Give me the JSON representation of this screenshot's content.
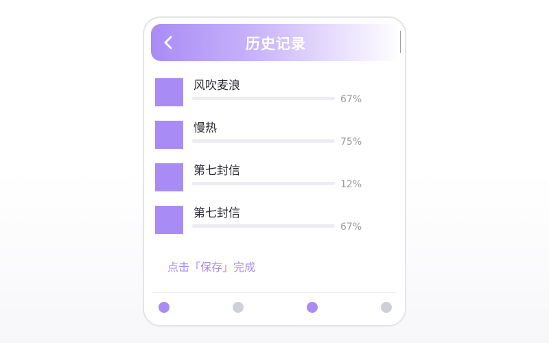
{
  "header": {
    "title": "历史记录",
    "back_icon": "chevron-left-icon"
  },
  "history": [
    {
      "title": "风吹麦浪",
      "progress_label": "67%",
      "progress": 0.67
    },
    {
      "title": "慢热",
      "progress_label": "75%",
      "progress": 0.75
    },
    {
      "title": "第七封信",
      "progress_label": "12%",
      "progress": 0.12
    },
    {
      "title": "第七封信",
      "progress_label": "67%",
      "progress": 0.67
    }
  ],
  "hint": "点击「保存」完成",
  "nav": {
    "dots": [
      {
        "active": true
      },
      {
        "active": false
      },
      {
        "active": true
      },
      {
        "active": false
      }
    ]
  },
  "colors": {
    "accent": "#a98bf5",
    "inactive": "#cdd0d6",
    "track": "#ececf2"
  }
}
